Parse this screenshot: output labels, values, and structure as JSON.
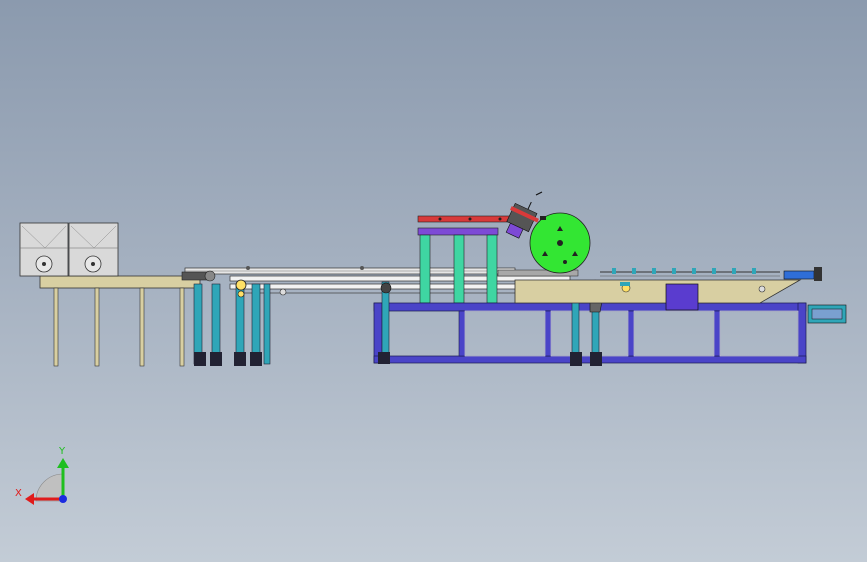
{
  "triad": {
    "x_label": "X",
    "y_label": "Y",
    "x_color": "#e01b1b",
    "y_color": "#1fbf1f",
    "z_color": "#1b2be0"
  },
  "colors": {
    "frame_blue": "#4a44c8",
    "leg_teal": "#2fa6b8",
    "column_green": "#3fd6a2",
    "drum_green": "#33e633",
    "table_tan": "#d8cfa2",
    "box_grey": "#d9d9d9",
    "beam_red": "#d83a3a",
    "beam_violet": "#7d4ad6"
  }
}
